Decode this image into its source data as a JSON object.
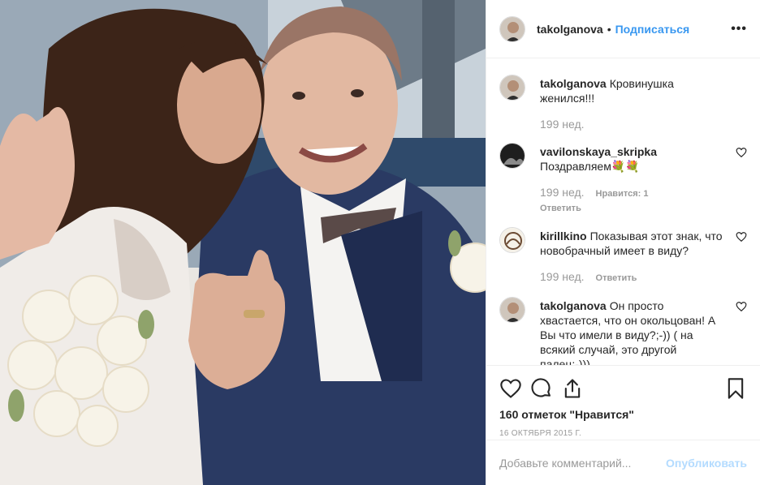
{
  "post": {
    "author": "takolganova",
    "follow_label": "Подписаться",
    "dot": "•",
    "more_label": "•••"
  },
  "comments": [
    {
      "author": "takolganova",
      "text": "Кровинушка женился!!!",
      "time": "199 нед.",
      "likes": "",
      "reply": ""
    },
    {
      "author": "vavilonskaya_skripka",
      "text": "Поздравляем💐💐",
      "time": "199 нед.",
      "likes": "Нравится: 1",
      "reply": "Ответить"
    },
    {
      "author": "kirillkino",
      "text": "Показывая этот знак, что новобрачный имеет в виду?",
      "time": "199 нед.",
      "likes": "",
      "reply": "Ответить"
    },
    {
      "author": "takolganova",
      "text": "Он просто хвастается, что он окольцован! А Вы что имели в виду?;-)) ( на всякий случай, это другой палец;-)))",
      "time": "",
      "likes": "",
      "reply": ""
    }
  ],
  "actions": {
    "likes_text": "160 отметок \"Нравится\"",
    "date": "16 октября 2015 г."
  },
  "add_comment": {
    "placeholder": "Добавьте комментарий...",
    "publish_label": "Опубликовать"
  },
  "icons": [
    "heart-icon",
    "comment-icon",
    "share-icon",
    "bookmark-icon",
    "more-icon"
  ],
  "colors": {
    "link": "#3897f0",
    "muted": "#999999",
    "publish_disabled": "#b3dbff"
  }
}
